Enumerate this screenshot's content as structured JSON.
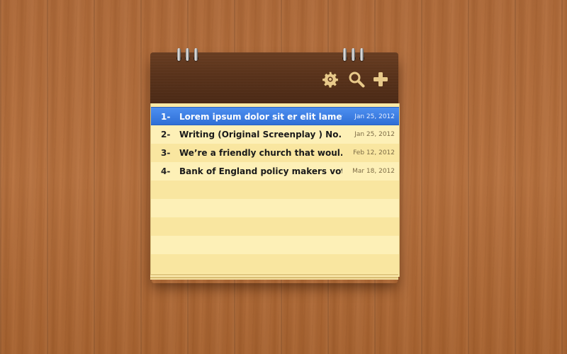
{
  "toolbar": {
    "settings_icon": "gear-icon",
    "search_icon": "search-icon",
    "add_icon": "plus-icon",
    "icon_color": "#e8c98a"
  },
  "notes": [
    {
      "number": "1-",
      "title": "Lorem ipsum dolor sit er elit lamet,...",
      "date": "Jan 25, 2012",
      "selected": true
    },
    {
      "number": "2-",
      "title": "Writing  (Original Screenplay ) No...",
      "date": "Jan 25, 2012",
      "selected": false
    },
    {
      "number": "3-",
      "title": "We’re a friendly church that woul...",
      "date": "Feb 12, 2012",
      "selected": false
    },
    {
      "number": "4-",
      "title": "Bank of England policy makers vote...",
      "date": "Mar 18, 2012",
      "selected": false
    }
  ],
  "colors": {
    "selection": "#3a7be0",
    "paper": "#fbe9a5",
    "header": "#5a331b"
  }
}
